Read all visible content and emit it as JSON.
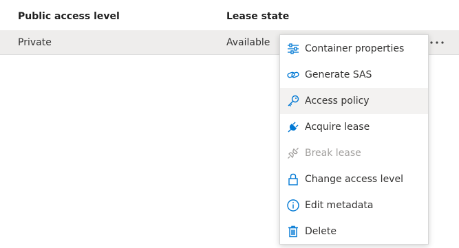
{
  "table": {
    "headers": {
      "public_access_level": "Public access level",
      "lease_state": "Lease state"
    },
    "rows": [
      {
        "public_access_level": "Private",
        "lease_state": "Available"
      }
    ],
    "row_actions_icon": "more-horizontal-icon"
  },
  "context_menu": {
    "items": [
      {
        "label": "Container properties",
        "icon": "properties-sliders-icon",
        "enabled": true,
        "hovered": false
      },
      {
        "label": "Generate SAS",
        "icon": "link-icon",
        "enabled": true,
        "hovered": false
      },
      {
        "label": "Access policy",
        "icon": "key-icon",
        "enabled": true,
        "hovered": true
      },
      {
        "label": "Acquire lease",
        "icon": "plug-icon",
        "enabled": true,
        "hovered": false
      },
      {
        "label": "Break lease",
        "icon": "unplug-icon",
        "enabled": false,
        "hovered": false
      },
      {
        "label": "Change access level",
        "icon": "lock-icon",
        "enabled": true,
        "hovered": false
      },
      {
        "label": "Edit metadata",
        "icon": "info-icon",
        "enabled": true,
        "hovered": false
      },
      {
        "label": "Delete",
        "icon": "trash-icon",
        "enabled": true,
        "hovered": false
      }
    ]
  },
  "colors": {
    "accent": "#0078d4",
    "disabled_icon": "#a19f9d",
    "row_background": "#eeedec",
    "menu_hover": "#f3f2f1"
  }
}
